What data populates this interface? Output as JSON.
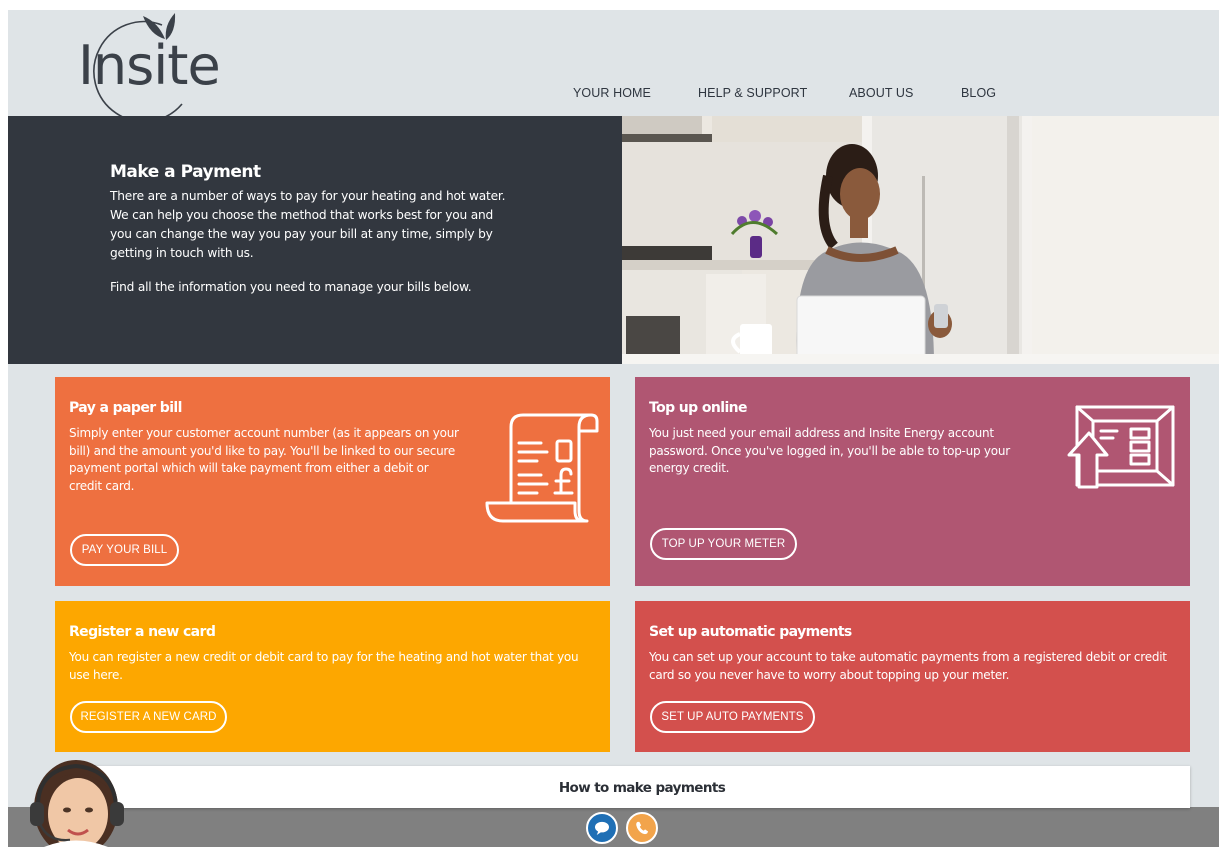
{
  "header": {
    "logo_text": "Insite",
    "nav": [
      {
        "label": "YOUR HOME"
      },
      {
        "label": "HELP & SUPPORT"
      },
      {
        "label": "ABOUT US"
      },
      {
        "label": "BLOG"
      }
    ]
  },
  "hero": {
    "title": "Make a Payment",
    "paragraph1": "There are a number of ways to pay for your heating and hot water. We can help you choose the method that works best for you and you can change the way you pay your bill at any time, simply by getting in touch with us.",
    "paragraph2": "Find all the information you need to manage your bills below."
  },
  "cards": [
    {
      "title": "Pay a paper bill",
      "text": "Simply enter your customer account number (as it appears on your bill) and the amount you'd like to pay. You'll be linked to our secure payment portal which will take payment from either a debit or credit card.",
      "button": "PAY YOUR BILL",
      "icon": "paper-bill-icon",
      "color": "#ee7040"
    },
    {
      "title": "Top up online",
      "text": "You just need your email address and Insite Energy account password. Once you've logged in, you'll be able to top-up your energy credit.",
      "button": "TOP UP YOUR METER",
      "icon": "top-up-meter-icon",
      "color": "#b05672"
    },
    {
      "title": "Register a new card",
      "text": "You can register a new credit or debit card to pay for the heating and hot water that you use here.",
      "button": "REGISTER A NEW CARD",
      "color": "#fda700"
    },
    {
      "title": "Set up automatic payments",
      "text": "You can set up your account to take automatic payments from a registered debit or credit card so you never have to worry about topping up your meter.",
      "button": "SET UP AUTO PAYMENTS",
      "color": "#d3504d"
    }
  ],
  "footer": {
    "howto_title": "How to make payments",
    "chat_icon": "chat-bubble-icon",
    "phone_icon": "phone-icon",
    "chat_color": "#1f6fb5",
    "phone_color": "#f2a44b"
  },
  "colors": {
    "page_bg": "#dfe4e7",
    "hero_bg": "#32373f",
    "footer_bar": "#808080"
  }
}
